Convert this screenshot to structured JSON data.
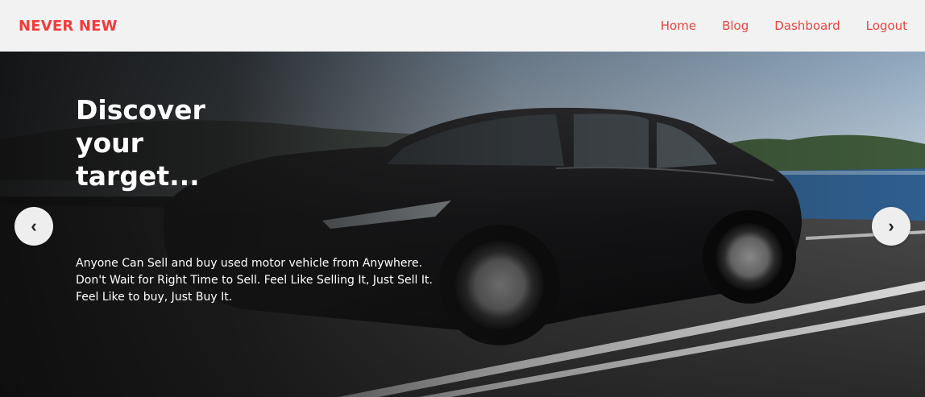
{
  "header": {
    "brand": "NEVER NEW",
    "nav": [
      {
        "label": "Home"
      },
      {
        "label": "Blog"
      },
      {
        "label": "Dashboard"
      },
      {
        "label": "Logout"
      }
    ]
  },
  "hero": {
    "title": "Discover your target...",
    "description_lines": [
      "Anyone Can Sell and buy used motor vehicle from Anywhere.",
      "Don't Wait for Right Time to Sell. Feel Like Selling It, Just Sell It.",
      "Feel Like to buy, Just Buy It."
    ],
    "prev_icon": "chevron-left-icon",
    "next_icon": "chevron-right-icon",
    "prev_glyph": "‹",
    "next_glyph": "›"
  },
  "colors": {
    "brand": "#f23b3b",
    "nav_link": "#e8473f",
    "navbar_bg": "#f2f2f2"
  }
}
